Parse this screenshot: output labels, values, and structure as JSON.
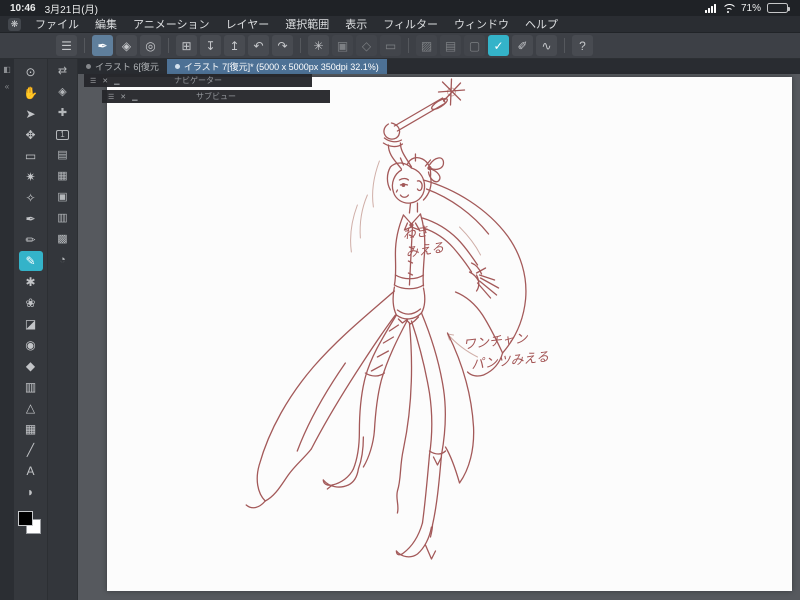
{
  "icons": {
    "logo": "❋",
    "hamburger": "☰",
    "close": "✕",
    "minimize": "▁"
  },
  "status_bar": {
    "time": "10:46",
    "date": "3月21日(月)",
    "battery_percent": "71%"
  },
  "menu_bar": {
    "items": [
      {
        "name": "file",
        "label": "ファイル"
      },
      {
        "name": "edit",
        "label": "編集"
      },
      {
        "name": "animation",
        "label": "アニメーション"
      },
      {
        "name": "layer",
        "label": "レイヤー"
      },
      {
        "name": "selection",
        "label": "選択範囲"
      },
      {
        "name": "view",
        "label": "表示"
      },
      {
        "name": "filter",
        "label": "フィルター"
      },
      {
        "name": "window",
        "label": "ウィンドウ"
      },
      {
        "name": "help",
        "label": "ヘルプ"
      }
    ]
  },
  "toolbar": {
    "icons": [
      {
        "name": "main-menu",
        "glyph": "☰"
      },
      {
        "sep": true
      },
      {
        "name": "pen-mode",
        "glyph": "✒",
        "selected": true
      },
      {
        "name": "decoration-mode",
        "glyph": "◈"
      },
      {
        "name": "gesture-mode",
        "glyph": "◎"
      },
      {
        "sep": true
      },
      {
        "name": "new-canvas",
        "glyph": "⊞"
      },
      {
        "name": "import-image",
        "glyph": "↧"
      },
      {
        "name": "share-export",
        "glyph": "↥"
      },
      {
        "name": "undo",
        "glyph": "↶"
      },
      {
        "name": "redo",
        "glyph": "↷"
      },
      {
        "sep": true
      },
      {
        "name": "filter-spinner",
        "glyph": "✳"
      },
      {
        "name": "duplicate",
        "glyph": "▣",
        "dim": true
      },
      {
        "name": "clear-layer",
        "glyph": "◇",
        "dim": true
      },
      {
        "name": "crop-canvas",
        "glyph": "▭",
        "dim": true
      },
      {
        "sep": true
      },
      {
        "name": "select-pen",
        "glyph": "▨",
        "dim": true
      },
      {
        "name": "select-overlay",
        "glyph": "▤",
        "dim": true
      },
      {
        "name": "deselect",
        "glyph": "▢",
        "dim": true
      },
      {
        "name": "selection-launcher",
        "glyph": "✓",
        "active": true
      },
      {
        "name": "stabilization-pen",
        "glyph": "✐"
      },
      {
        "name": "line-smoothing",
        "glyph": "∿"
      },
      {
        "sep": true
      },
      {
        "name": "help",
        "glyph": "?"
      }
    ]
  },
  "edge_strip": {
    "icons": [
      {
        "name": "palette-dock",
        "glyph": "◧"
      },
      {
        "name": "collapse-strip",
        "glyph": "«"
      }
    ]
  },
  "left_toolbar": {
    "tools": [
      {
        "name": "zoom-tool",
        "glyph": "⊙"
      },
      {
        "name": "move-view-tool",
        "glyph": "✋"
      },
      {
        "name": "operation-tool",
        "glyph": "➤"
      },
      {
        "name": "layer-move-tool",
        "glyph": "✥"
      },
      {
        "name": "selection-tool",
        "glyph": "▭"
      },
      {
        "name": "auto-select-tool",
        "glyph": "✷"
      },
      {
        "name": "eyedropper-tool",
        "glyph": "✧"
      },
      {
        "name": "pen-tool",
        "glyph": "✒"
      },
      {
        "name": "pencil-tool",
        "glyph": "✏"
      },
      {
        "name": "marker-tool",
        "glyph": "✎",
        "active": true
      },
      {
        "name": "airbrush-tool",
        "glyph": "✱"
      },
      {
        "name": "decoration-tool",
        "glyph": "❀"
      },
      {
        "name": "eraser-tool",
        "glyph": "◪"
      },
      {
        "name": "blend-tool",
        "glyph": "◉"
      },
      {
        "name": "fill-tool",
        "glyph": "◆"
      },
      {
        "name": "gradient-tool",
        "glyph": "▥"
      },
      {
        "name": "figure-tool",
        "glyph": "△"
      },
      {
        "name": "frame-tool",
        "glyph": "▦"
      },
      {
        "name": "ruler-tool",
        "glyph": "╱"
      },
      {
        "name": "text-tool",
        "glyph": "A"
      },
      {
        "name": "balloon-tool",
        "glyph": "◗"
      }
    ],
    "main_color": "#000000",
    "sub_color": "#ffffff"
  },
  "palette_dock": {
    "icons": [
      {
        "name": "tool-switch",
        "glyph": "⇄"
      },
      {
        "name": "transform-panel",
        "glyph": "◈"
      },
      {
        "name": "move-canvas-panel",
        "glyph": "✚"
      },
      {
        "name": "brush-size-palette",
        "glyph": "1",
        "boxed": true
      },
      {
        "name": "color-set-palette",
        "glyph": "▤"
      },
      {
        "name": "canvas-settings",
        "glyph": "▦"
      },
      {
        "name": "layer-palette",
        "glyph": "▣"
      },
      {
        "name": "material-palette",
        "glyph": "▥"
      },
      {
        "name": "navigator-palette",
        "glyph": "▩"
      },
      {
        "name": "timelapse-panel",
        "glyph": "◔"
      }
    ]
  },
  "tabs": [
    {
      "label": "イラスト 6[復元",
      "active": false
    },
    {
      "label": "イラスト 7[復元]* (5000 x 5000px 350dpi 32.1%)",
      "active": true
    }
  ],
  "float_panels": [
    {
      "title": "ナビゲーター"
    },
    {
      "title": "サブビュー"
    }
  ],
  "sketch": {
    "note1_line1": "わき",
    "note1_line2": "みえる",
    "note2_line1": "ワンチャン",
    "note2_line2": "パンツみえる",
    "stroke_color": "#9a4848"
  }
}
